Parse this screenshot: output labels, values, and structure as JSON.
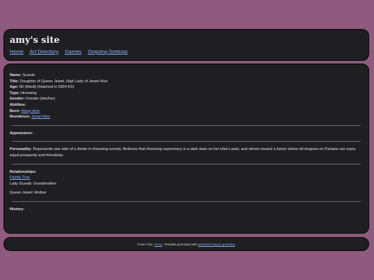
{
  "header": {
    "title": "amy's site",
    "nav": [
      "Home",
      "Art Directory",
      "Games",
      "Ongoing Settings"
    ]
  },
  "profile": {
    "name_label": "Name:",
    "name": "Scarab",
    "title_label": "Title:",
    "title": "Daughter of Queen Jewel, High Lady of Jewel Hive",
    "age_label": "Age:",
    "age": "66 (Adult) (Hatched in 5064 AS)",
    "type_label": "Type:",
    "type": "Hivewing",
    "gender_label": "Gender:",
    "gender": "Female (she/her)",
    "abilities_label": "Abilities:",
    "born_label": "Born:",
    "born": "Wasp Hive",
    "residence_label": "Residence:",
    "residence": "Jewel Hive"
  },
  "appearance": {
    "label": "Appearance:"
  },
  "personality": {
    "label": "Personality:",
    "text": "Represents one side of a divide in Hivewing society. Believes that Hivewing supremacy is a dark stain on her tribe's past, and strives toward a future where all dragons on Pantala can enjoy equal prosperity and friendship."
  },
  "relationships": {
    "label": "Relationships:",
    "family_tree": "Family Tree",
    "items": [
      "Lady Scarab: Grandmother",
      "Queen Jewel: Mother"
    ]
  },
  "history": {
    "label": "History:"
  },
  "footer": {
    "prefix": "Footer Text. ",
    "home_link": "Home",
    "middle": ". Template generated with ",
    "generator_link": "sebaized's layout generator"
  },
  "colors": {
    "background": "#8e5a7e",
    "panel": "#1f1f21",
    "link": "#8ab0ff"
  }
}
